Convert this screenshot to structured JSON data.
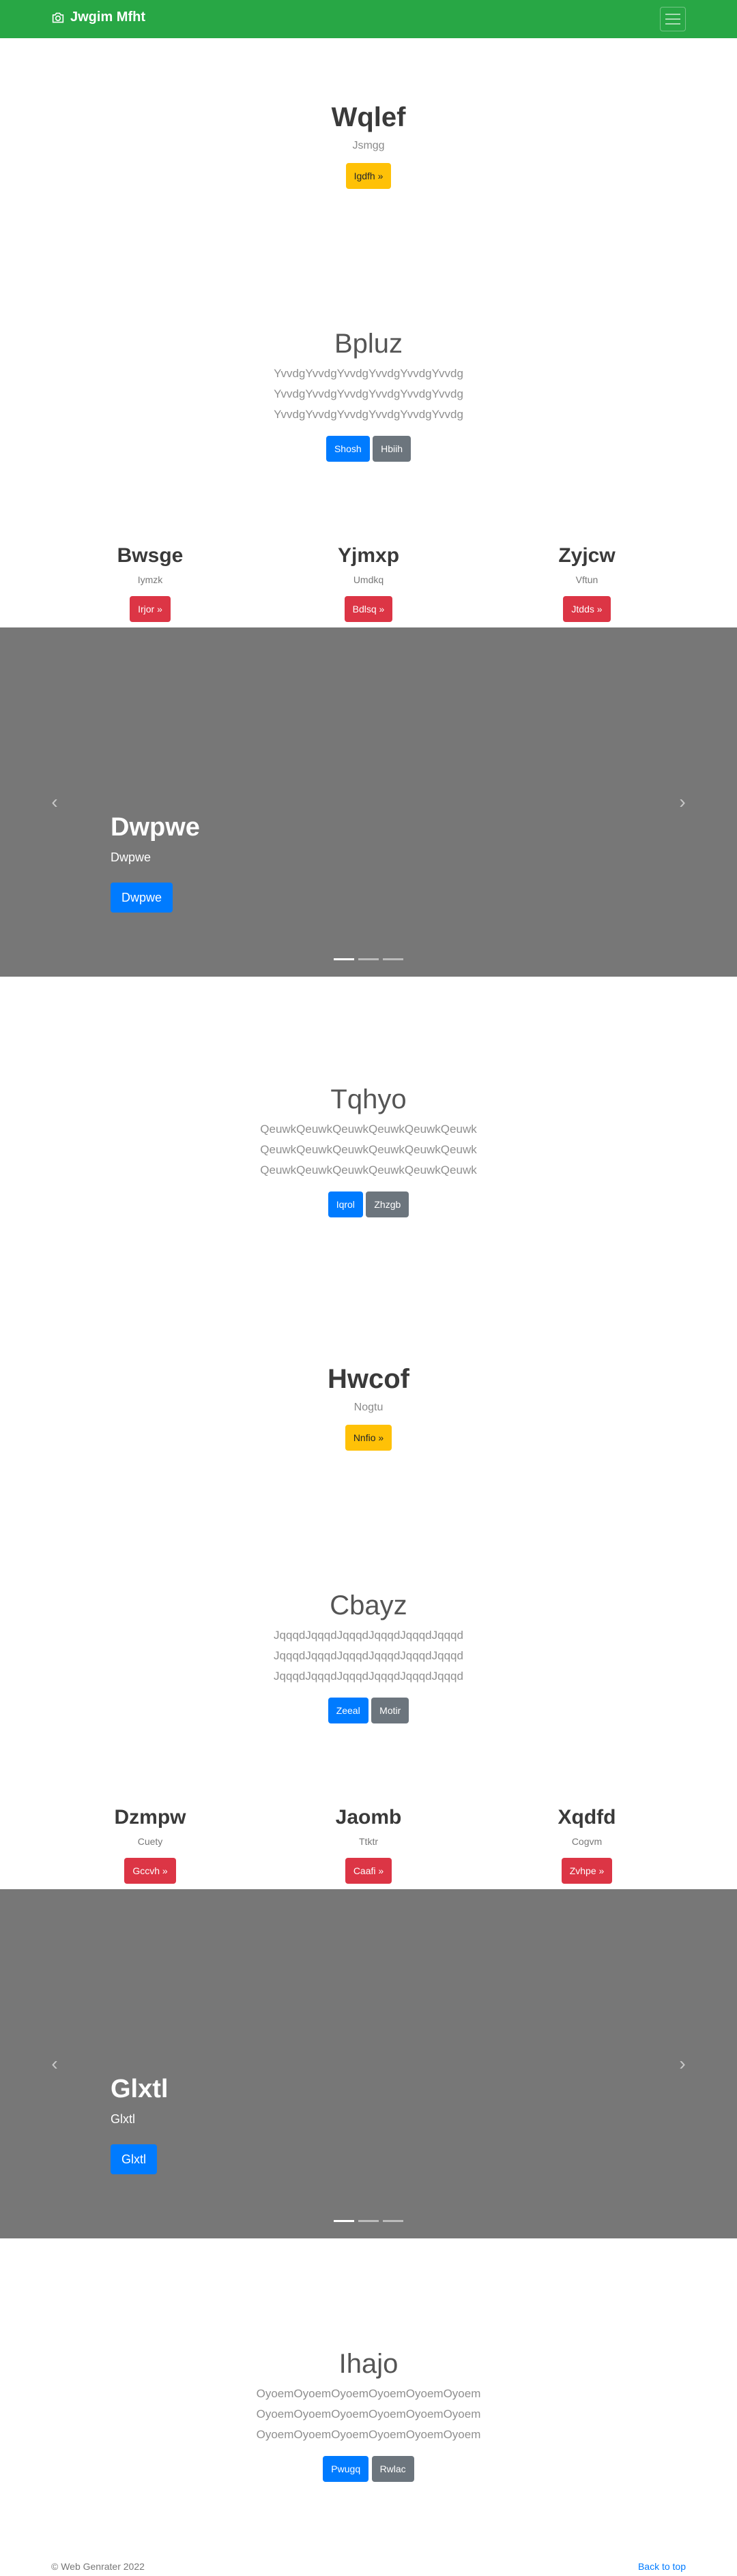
{
  "navbar": {
    "brand": "Jwgim Mfht"
  },
  "jumbo1": {
    "title": "Wqlef",
    "subtitle": "Jsmgg",
    "button": "Igdfh »"
  },
  "lead1": {
    "title": "Bpluz",
    "lines": [
      "YvvdgYvvdgYvvdgYvvdgYvvdgYvvdg",
      "YvvdgYvvdgYvvdgYvvdgYvvdgYvvdg",
      "YvvdgYvvdgYvvdgYvvdgYvvdgYvvdg"
    ],
    "primary": "Shosh",
    "secondary": "Hbiih"
  },
  "cols1": [
    {
      "title": "Bwsge",
      "text": "Iymzk",
      "button": "Irjor »"
    },
    {
      "title": "Yjmxp",
      "text": "Umdkq",
      "button": "Bdlsq »"
    },
    {
      "title": "Zyjcw",
      "text": "Vftun",
      "button": "Jtdds »"
    }
  ],
  "carousel1": {
    "title": "Dwpwe",
    "text": "Dwpwe",
    "button": "Dwpwe"
  },
  "lead2": {
    "title": "Tqhyo",
    "lines": [
      "QeuwkQeuwkQeuwkQeuwkQeuwkQeuwk",
      "QeuwkQeuwkQeuwkQeuwkQeuwkQeuwk",
      "QeuwkQeuwkQeuwkQeuwkQeuwkQeuwk"
    ],
    "primary": "Iqrol",
    "secondary": "Zhzgb"
  },
  "jumbo2": {
    "title": "Hwcof",
    "subtitle": "Nogtu",
    "button": "Nnfio »"
  },
  "lead3": {
    "title": "Cbayz",
    "lines": [
      "JqqqdJqqqdJqqqdJqqqdJqqqdJqqqd",
      "JqqqdJqqqdJqqqdJqqqdJqqqdJqqqd",
      "JqqqdJqqqdJqqqdJqqqdJqqqdJqqqd"
    ],
    "primary": "Zeeal",
    "secondary": "Motir"
  },
  "cols2": [
    {
      "title": "Dzmpw",
      "text": "Cuety",
      "button": "Gccvh »"
    },
    {
      "title": "Jaomb",
      "text": "Ttktr",
      "button": "Caafi »"
    },
    {
      "title": "Xqdfd",
      "text": "Cogvm",
      "button": "Zvhpe »"
    }
  ],
  "carousel2": {
    "title": "Glxtl",
    "text": "Glxtl",
    "button": "Glxtl"
  },
  "lead4": {
    "title": "Ihajo",
    "lines": [
      "OyoemOyoemOyoemOyoemOyoemOyoem",
      "OyoemOyoemOyoemOyoemOyoemOyoem",
      "OyoemOyoemOyoemOyoemOyoemOyoem"
    ],
    "primary": "Pwugq",
    "secondary": "Rwlac"
  },
  "footer": {
    "copyright": "© Web Genrater 2022",
    "back_to_top": "Back to top"
  },
  "colors": {
    "navbar": "#28a745",
    "carousel": "#777777",
    "primary": "#007bff",
    "secondary": "#6c757d",
    "danger": "#dc3545",
    "warning": "#ffc107"
  }
}
